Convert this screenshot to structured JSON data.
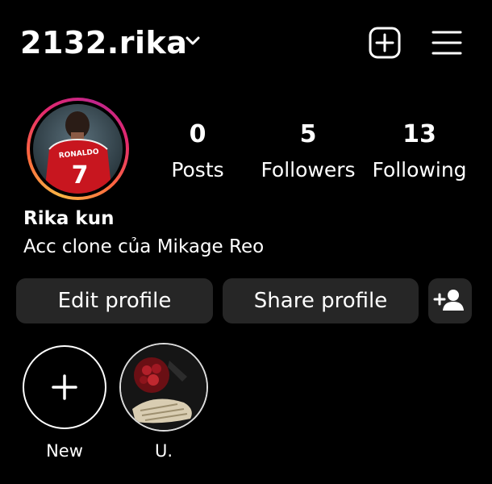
{
  "header": {
    "username": "2132.rika",
    "icons": {
      "dropdown": "chevron-down-icon",
      "new_post": "plus-square-icon",
      "menu": "hamburger-menu-icon"
    }
  },
  "profile": {
    "avatar": "profile-picture",
    "jersey_text": "RONALDO",
    "jersey_number": "7",
    "display_name": "Rika kun",
    "bio": "Acc clone của Mikage Reo"
  },
  "stats": [
    {
      "value": "0",
      "label": "Posts"
    },
    {
      "value": "5",
      "label": "Followers"
    },
    {
      "value": "13",
      "label": "Following"
    }
  ],
  "actions": {
    "edit": "Edit profile",
    "share": "Share profile",
    "discover_icon": "add-person-icon"
  },
  "highlights": [
    {
      "label": "New",
      "icon": "plus-icon"
    },
    {
      "label": "U."
    }
  ],
  "colors": {
    "background": "#000000",
    "button": "#262626",
    "text": "#ffffff"
  }
}
